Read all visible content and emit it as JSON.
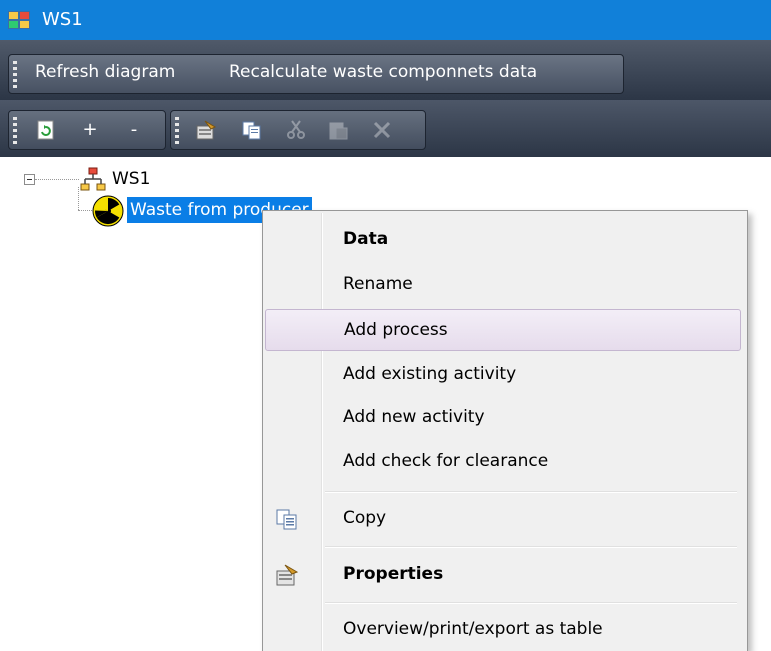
{
  "window": {
    "title": "WS1"
  },
  "menu": {
    "refresh_label": "Refresh diagram",
    "recalc_label": "Recalculate waste componnets data"
  },
  "toolbar": {
    "plus_label": "+",
    "minus_label": "-"
  },
  "tree": {
    "root_label": "WS1",
    "child_label": "Waste from producer"
  },
  "context_menu": {
    "items": [
      {
        "label": "Data",
        "bold": true
      },
      {
        "label": "Rename"
      },
      {
        "label": "Add process",
        "highlighted": true
      },
      {
        "label": "Add existing activity"
      },
      {
        "label": "Add new activity"
      },
      {
        "label": "Add check for clearance"
      },
      {
        "label": "Copy",
        "icon": "copy-icon"
      },
      {
        "label": "Properties",
        "bold": true,
        "icon": "properties-icon"
      },
      {
        "label": "Overview/print/export as table"
      }
    ]
  },
  "colors": {
    "titlebar": "#1180d9",
    "selection": "#0a7ee6",
    "toolbar_dark": "#2c3646"
  }
}
